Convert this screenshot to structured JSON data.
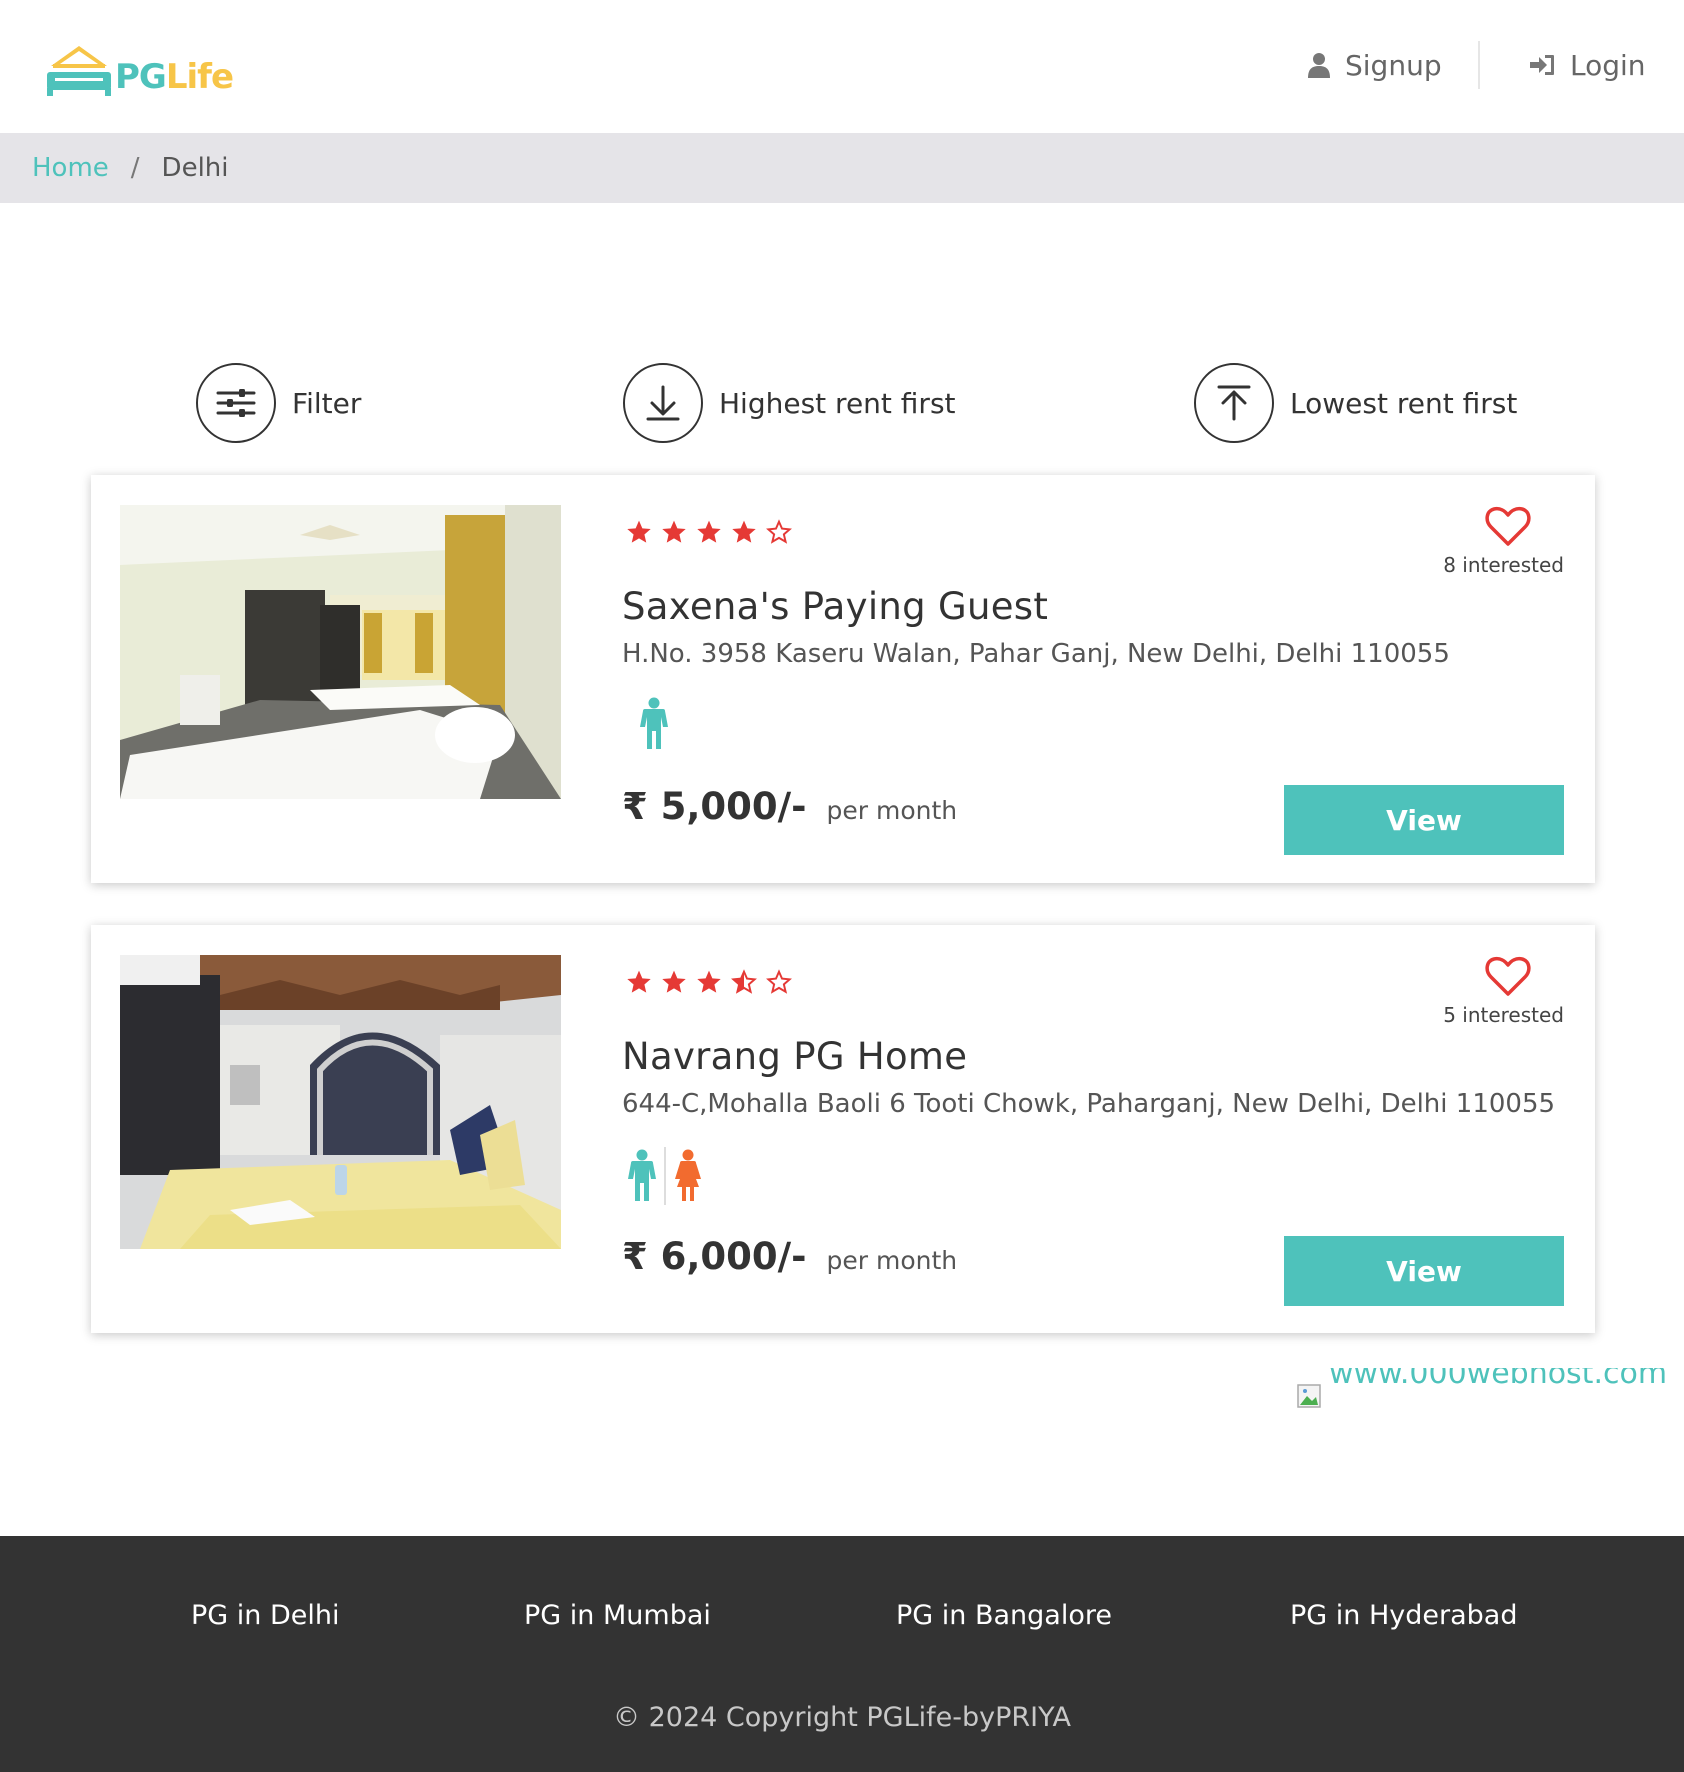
{
  "header": {
    "logo": {
      "part1": "PG",
      "part2": "Life"
    },
    "signup_label": "Signup",
    "login_label": "Login"
  },
  "breadcrumb": {
    "home": "Home",
    "separator": "/",
    "current": "Delhi"
  },
  "sort_bar": {
    "filter_label": "Filter",
    "highest_label": "Highest rent first",
    "lowest_label": "Lowest rent first"
  },
  "listings": [
    {
      "name": "Saxena's Paying Guest",
      "address": "H.No. 3958 Kaseru Walan, Pahar Ganj, New Delhi, Delhi 110055",
      "rating": 4,
      "rating_max": 5,
      "interested": "8 interested",
      "gender": [
        "male"
      ],
      "rent": "₹ 5,000/-",
      "rent_unit": "per month",
      "view_label": "View"
    },
    {
      "name": "Navrang PG Home",
      "address": "644-C,Mohalla Baoli 6 Tooti Chowk, Paharganj, New Delhi, Delhi 110055",
      "rating": 3.5,
      "rating_max": 5,
      "interested": "5 interested",
      "gender": [
        "male",
        "female"
      ],
      "rent": "₹ 6,000/-",
      "rent_unit": "per month",
      "view_label": "View"
    }
  ],
  "watermark": {
    "text": "www.000webhost.com"
  },
  "footer": {
    "links": [
      "PG in Delhi",
      "PG in Mumbai",
      "PG in Bangalore",
      "PG in Hyderabad"
    ],
    "copyright": "© 2024 Copyright PGLife-byPRIYA"
  },
  "colors": {
    "accent": "#4ec2bb",
    "logo_yellow": "#f7c548",
    "star_red": "#e53935",
    "female_orange": "#f26b2f",
    "footer_bg": "#333333",
    "breadcrumb_bg": "#e5e4e8"
  },
  "icons": {
    "signup": "user-icon",
    "login": "sign-in-icon",
    "filter": "sliders-icon",
    "highest": "arrow-down-icon",
    "lowest": "arrow-up-icon",
    "heart": "heart-outline-icon",
    "male": "male-icon",
    "female": "female-icon"
  }
}
